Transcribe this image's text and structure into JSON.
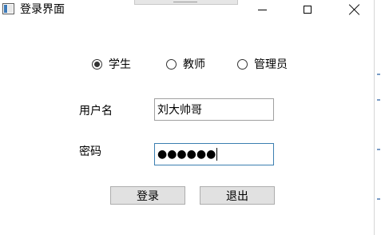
{
  "window": {
    "title": "登录界面",
    "icon": "window-app-icon",
    "controls": [
      "minimize-icon",
      "maximize-icon",
      "close-icon"
    ]
  },
  "role_options": [
    {
      "label": "学生",
      "checked": true
    },
    {
      "label": "教师",
      "checked": false
    },
    {
      "label": "管理员",
      "checked": false
    }
  ],
  "form": {
    "username_label": "用户名",
    "username_value": "刘大帅哥",
    "password_label": "密码",
    "password_masked": "●●●●●●"
  },
  "buttons": {
    "login_label": "登录",
    "exit_label": "退出"
  },
  "colors": {
    "button_bg": "#e1e1e1",
    "focus_border": "#3c7fb1",
    "textbox_border": "#a0a0a0"
  }
}
